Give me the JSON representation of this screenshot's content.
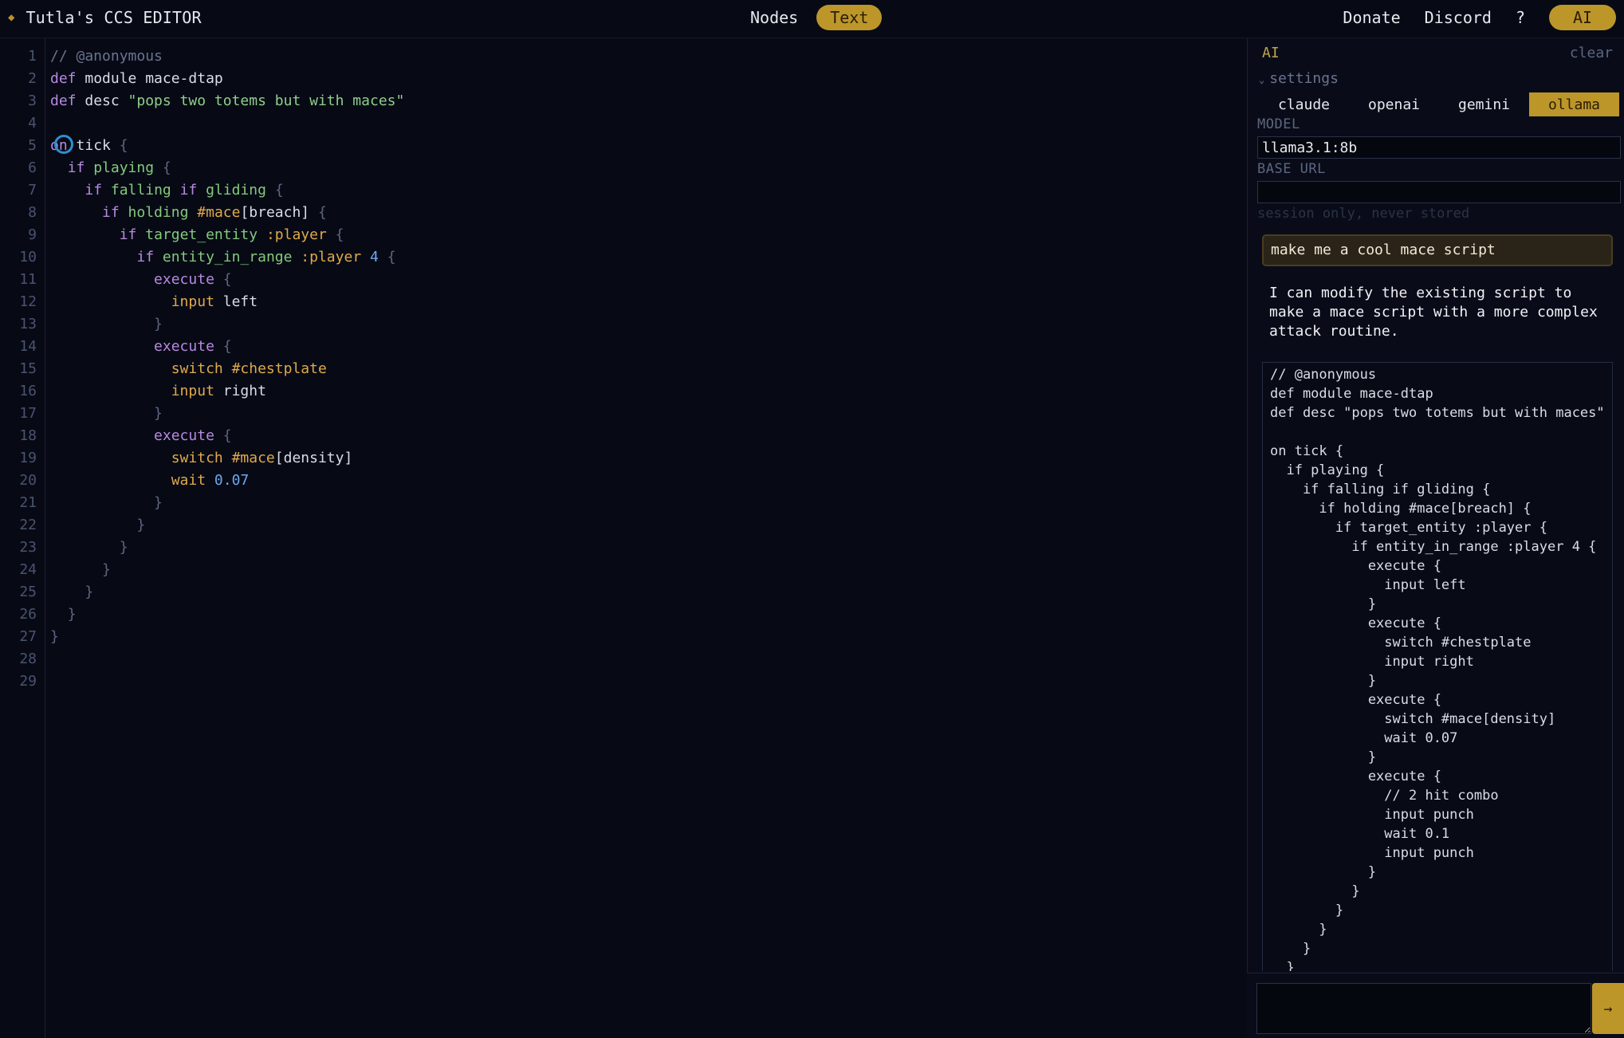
{
  "app": {
    "title": "Tutla's CCS EDITOR",
    "modes": [
      "Nodes",
      "Text"
    ],
    "active_mode": "Text",
    "links": {
      "donate": "Donate",
      "discord": "Discord",
      "help": "?",
      "ai": "AI"
    }
  },
  "colors": {
    "accent": "#bd962a",
    "background": "#070a15"
  },
  "editor": {
    "line_numbers": [
      "1",
      "2",
      "3",
      "4",
      "5",
      "6",
      "7",
      "8",
      "9",
      "10",
      "11",
      "12",
      "13",
      "14",
      "15",
      "16",
      "17",
      "18",
      "19",
      "20",
      "21",
      "22",
      "23",
      "24",
      "25",
      "26",
      "27",
      "28",
      "29"
    ],
    "lines": [
      [
        {
          "t": "// @anonymous",
          "c": "comment"
        }
      ],
      [
        {
          "t": "def",
          "c": "kw"
        },
        {
          "t": " module mace-dtap",
          "c": "plain"
        }
      ],
      [
        {
          "t": "def",
          "c": "kw"
        },
        {
          "t": " desc ",
          "c": "plain"
        },
        {
          "t": "\"pops two totems but with maces\"",
          "c": "str"
        }
      ],
      [],
      [
        {
          "t": "on",
          "c": "kw"
        },
        {
          "t": " tick ",
          "c": "ev"
        },
        {
          "t": "{",
          "c": "br"
        }
      ],
      [
        {
          "t": "  ",
          "c": "plain"
        },
        {
          "t": "if",
          "c": "kw"
        },
        {
          "t": " playing ",
          "c": "cond"
        },
        {
          "t": "{",
          "c": "br"
        }
      ],
      [
        {
          "t": "    ",
          "c": "plain"
        },
        {
          "t": "if",
          "c": "kw"
        },
        {
          "t": " falling ",
          "c": "cond"
        },
        {
          "t": "if",
          "c": "kw"
        },
        {
          "t": " gliding ",
          "c": "cond"
        },
        {
          "t": "{",
          "c": "br"
        }
      ],
      [
        {
          "t": "      ",
          "c": "plain"
        },
        {
          "t": "if",
          "c": "kw"
        },
        {
          "t": " holding ",
          "c": "cond"
        },
        {
          "t": "#mace",
          "c": "item"
        },
        {
          "t": "[breach] ",
          "c": "plain"
        },
        {
          "t": "{",
          "c": "br"
        }
      ],
      [
        {
          "t": "        ",
          "c": "plain"
        },
        {
          "t": "if",
          "c": "kw"
        },
        {
          "t": " target_entity ",
          "c": "cond"
        },
        {
          "t": ":player ",
          "c": "ent"
        },
        {
          "t": "{",
          "c": "br"
        }
      ],
      [
        {
          "t": "          ",
          "c": "plain"
        },
        {
          "t": "if",
          "c": "kw"
        },
        {
          "t": " entity_in_range ",
          "c": "cond"
        },
        {
          "t": ":player ",
          "c": "ent"
        },
        {
          "t": "4 ",
          "c": "num"
        },
        {
          "t": "{",
          "c": "br"
        }
      ],
      [
        {
          "t": "            ",
          "c": "plain"
        },
        {
          "t": "execute ",
          "c": "act"
        },
        {
          "t": "{",
          "c": "br"
        }
      ],
      [
        {
          "t": "              ",
          "c": "plain"
        },
        {
          "t": "input",
          "c": "argk"
        },
        {
          "t": " left",
          "c": "argv"
        }
      ],
      [
        {
          "t": "            ",
          "c": "plain"
        },
        {
          "t": "}",
          "c": "br"
        }
      ],
      [
        {
          "t": "            ",
          "c": "plain"
        },
        {
          "t": "execute ",
          "c": "act"
        },
        {
          "t": "{",
          "c": "br"
        }
      ],
      [
        {
          "t": "              ",
          "c": "plain"
        },
        {
          "t": "switch #chestplate",
          "c": "argk"
        }
      ],
      [
        {
          "t": "              ",
          "c": "plain"
        },
        {
          "t": "input",
          "c": "argk"
        },
        {
          "t": " right",
          "c": "argv"
        }
      ],
      [
        {
          "t": "            ",
          "c": "plain"
        },
        {
          "t": "}",
          "c": "br"
        }
      ],
      [
        {
          "t": "            ",
          "c": "plain"
        },
        {
          "t": "execute ",
          "c": "act"
        },
        {
          "t": "{",
          "c": "br"
        }
      ],
      [
        {
          "t": "              ",
          "c": "plain"
        },
        {
          "t": "switch #mace",
          "c": "argk"
        },
        {
          "t": "[density]",
          "c": "plain"
        }
      ],
      [
        {
          "t": "              ",
          "c": "plain"
        },
        {
          "t": "wait",
          "c": "argk"
        },
        {
          "t": " 0.07",
          "c": "num"
        }
      ],
      [
        {
          "t": "            ",
          "c": "plain"
        },
        {
          "t": "}",
          "c": "br"
        }
      ],
      [
        {
          "t": "          ",
          "c": "plain"
        },
        {
          "t": "}",
          "c": "br"
        }
      ],
      [
        {
          "t": "        ",
          "c": "plain"
        },
        {
          "t": "}",
          "c": "br"
        }
      ],
      [
        {
          "t": "      ",
          "c": "plain"
        },
        {
          "t": "}",
          "c": "br"
        }
      ],
      [
        {
          "t": "    ",
          "c": "plain"
        },
        {
          "t": "}",
          "c": "br"
        }
      ],
      [
        {
          "t": "  ",
          "c": "plain"
        },
        {
          "t": "}",
          "c": "br"
        }
      ],
      [
        {
          "t": "}",
          "c": "br"
        }
      ],
      [],
      []
    ]
  },
  "ai_panel": {
    "label": "AI",
    "clear": "clear",
    "settings_label": "settings",
    "providers": [
      "claude",
      "openai",
      "gemini",
      "ollama"
    ],
    "active_provider": "ollama",
    "model_label": "MODEL",
    "model_value": "llama3.1:8b",
    "base_url_label": "BASE URL",
    "base_url_value": "",
    "session_note": "session only, never stored",
    "user_message": "make me a cool mace script",
    "ai_message": "I can modify the existing script to make a mace script with a more complex attack routine.",
    "ai_code": [
      "// @anonymous",
      "def module mace-dtap",
      "def desc \"pops two totems but with maces\"",
      "",
      "on tick {",
      "  if playing {",
      "    if falling if gliding {",
      "      if holding #mace[breach] {",
      "        if target_entity :player {",
      "          if entity_in_range :player 4 {",
      "            execute {",
      "              input left",
      "            }",
      "            execute {",
      "              switch #chestplate",
      "              input right",
      "            }",
      "            execute {",
      "              switch #mace[density]",
      "              wait 0.07",
      "            }",
      "            execute {",
      "              // 2 hit combo",
      "              input punch",
      "              wait 0.1",
      "              input punch",
      "            }",
      "          }",
      "        }",
      "      }",
      "    }",
      "  }"
    ],
    "composer_placeholder": "",
    "send_icon": "arrow-right-icon",
    "send_glyph": "→"
  }
}
